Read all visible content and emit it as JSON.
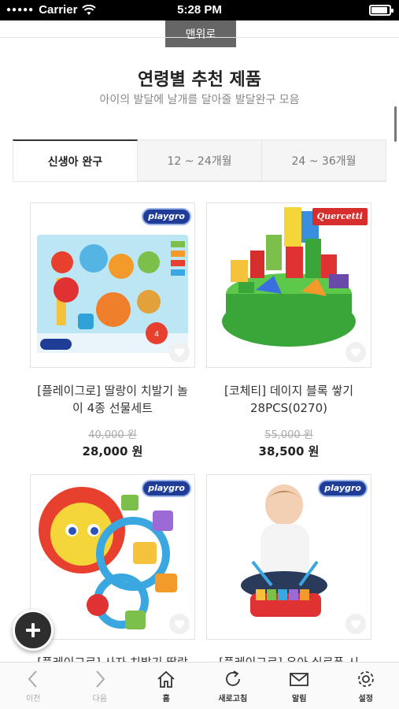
{
  "status_bar": {
    "carrier": "Carrier",
    "time": "5:28 PM",
    "battery_level": 0.9
  },
  "scroll_top_label": "맨위로",
  "header": {
    "title": "연령별 추천 제품",
    "subtitle": "아이의 발달에 날개를 달아줄 발달완구 모음"
  },
  "tabs": [
    {
      "label": "신생아 완구",
      "active": true
    },
    {
      "label": "12 ~ 24개월",
      "active": false
    },
    {
      "label": "24 ~ 36개월",
      "active": false
    }
  ],
  "products": [
    {
      "brand": "playgro",
      "name_line1": "[플레이그로] 딸랑이 치발기 놀",
      "name_line2": "이 4종 선물세트",
      "original_price": "40,000 원",
      "price": "28,000 원"
    },
    {
      "brand": "Quercetti",
      "name_line1": "[코체티] 데이지 블록 쌓기",
      "name_line2": "28PCS(0270)",
      "original_price": "55,000 원",
      "price": "38,500 원"
    },
    {
      "brand": "playgro",
      "name_line1": "[플레이그로] 사자 치발기 딸랑",
      "name_line2": ""
    },
    {
      "brand": "playgro",
      "name_line1": "[플레이그로] 유아 실로폰 시",
      "name_line2": ""
    }
  ],
  "toolbar": [
    {
      "label": "이전",
      "icon": "back-chevron-icon"
    },
    {
      "label": "다음",
      "icon": "forward-chevron-icon"
    },
    {
      "label": "홈",
      "icon": "home-icon"
    },
    {
      "label": "새로고침",
      "icon": "refresh-icon"
    },
    {
      "label": "알림",
      "icon": "mail-icon"
    },
    {
      "label": "설정",
      "icon": "gear-icon"
    }
  ],
  "colors": {
    "status_bar": "#000000",
    "scroll_top": "#666666",
    "fab": "#2e2e2e",
    "badge_blue": "#1f3c96",
    "badge_red": "#d62d2d"
  }
}
